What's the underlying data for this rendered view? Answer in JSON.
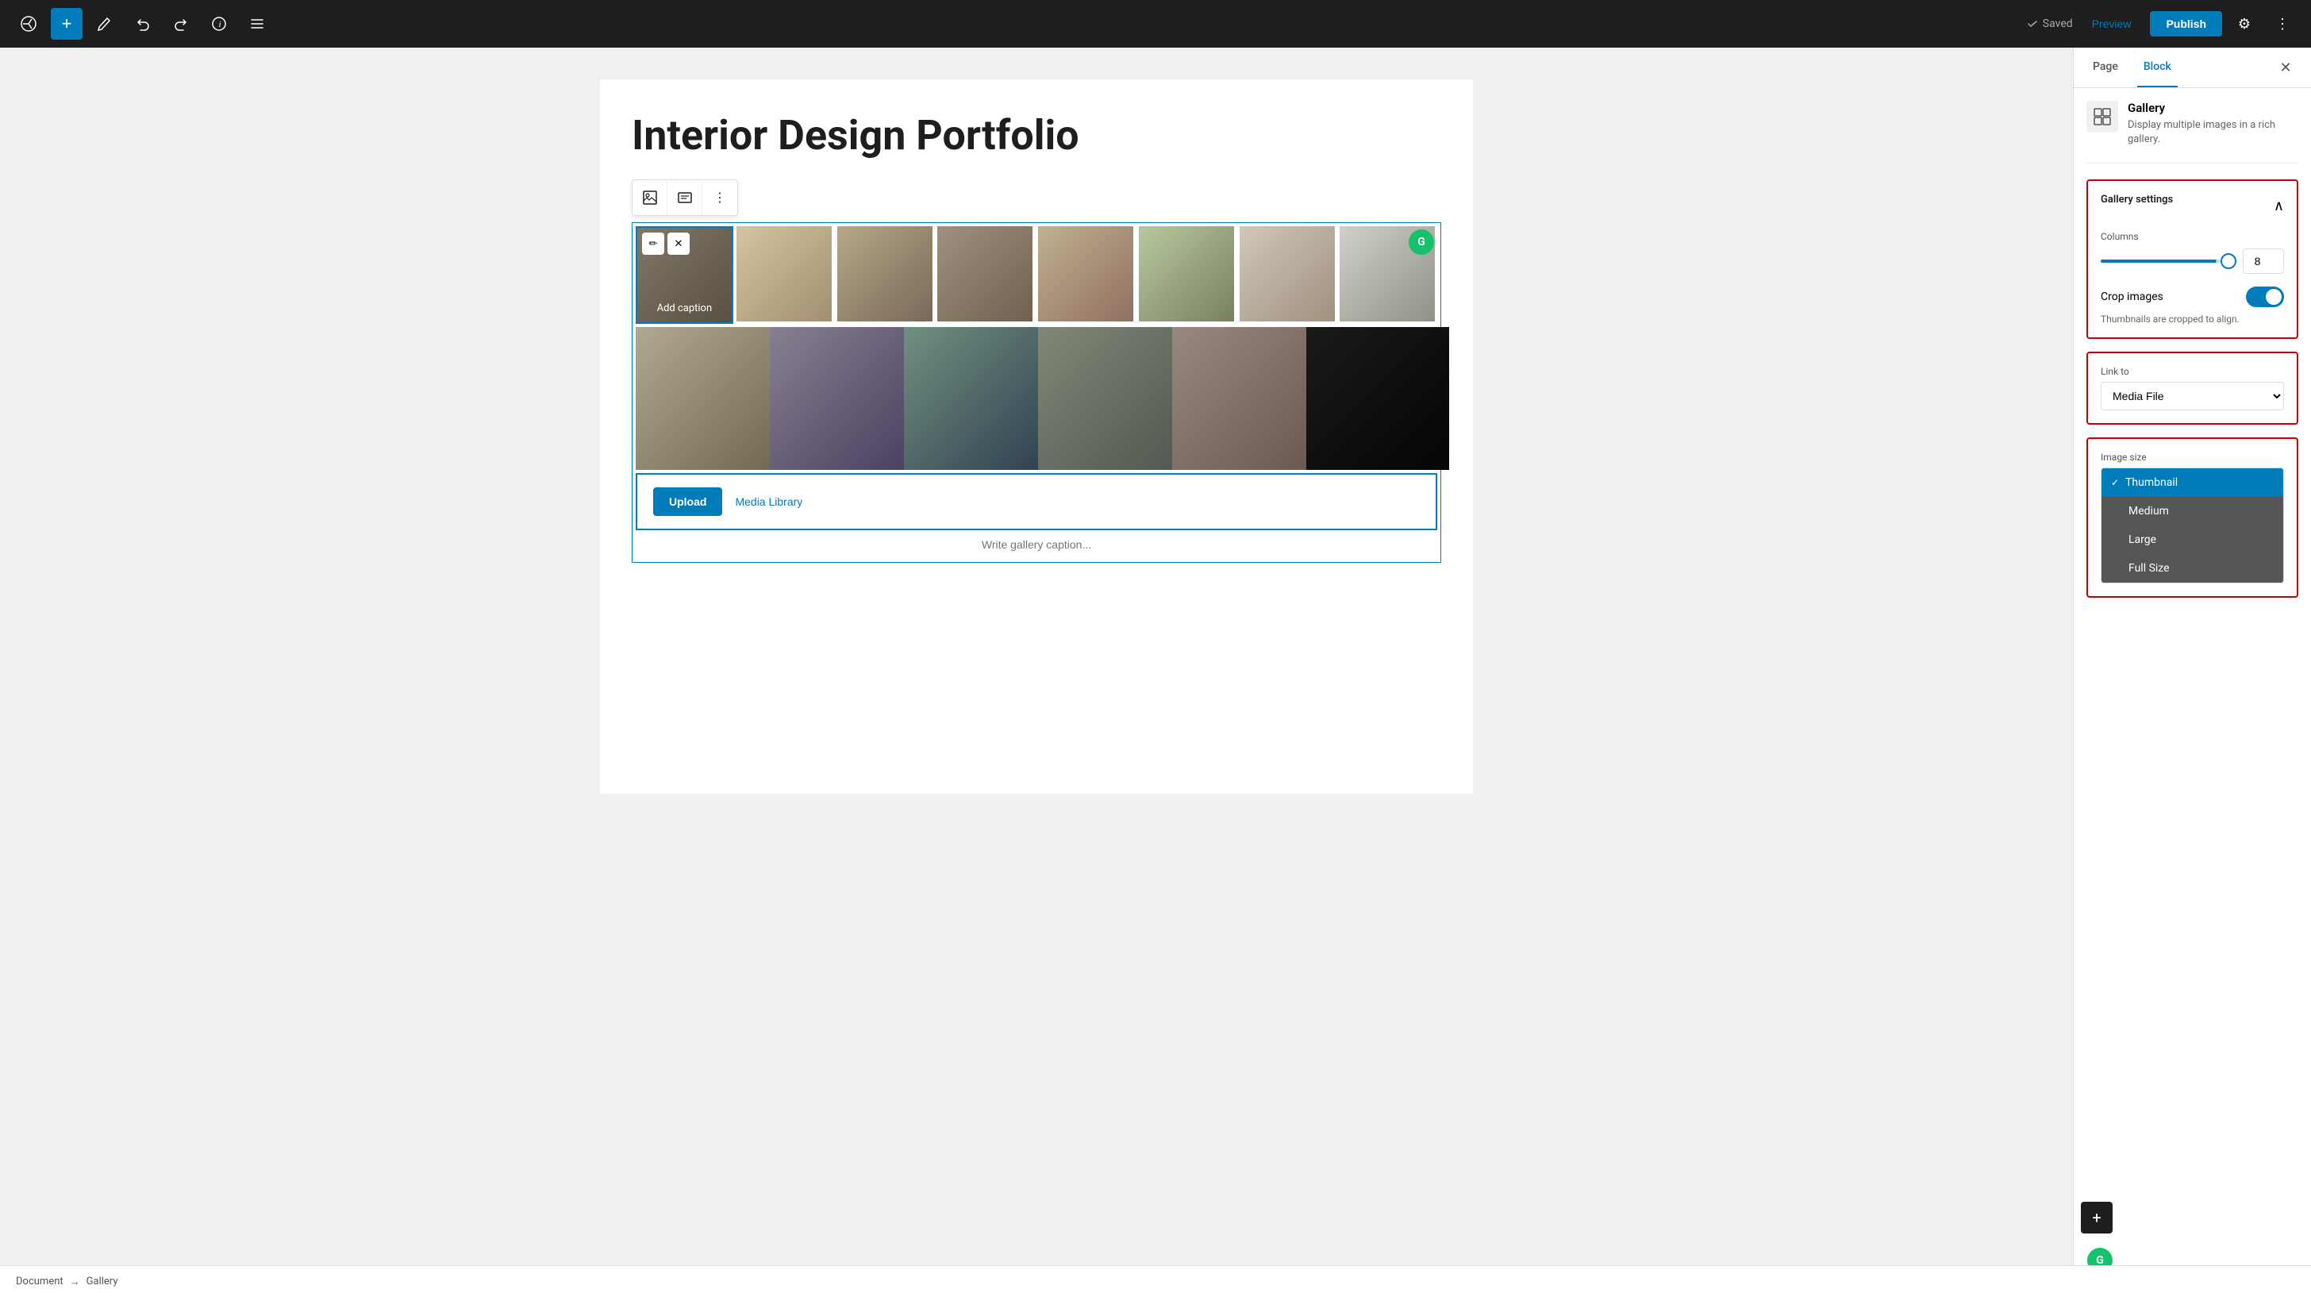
{
  "toolbar": {
    "add_label": "+",
    "saved_label": "Saved",
    "preview_label": "Preview",
    "publish_label": "Publish"
  },
  "editor": {
    "page_title": "Interior Design Portfolio",
    "gallery_caption_placeholder": "Write gallery caption...",
    "add_caption": "Add caption",
    "upload_label": "Upload",
    "media_library_label": "Media Library",
    "columns_value": "8",
    "crop_images_label": "Crop images",
    "crop_images_hint": "Thumbnails are cropped to align."
  },
  "sidebar": {
    "page_tab": "Page",
    "block_tab": "Block",
    "block_name": "Gallery",
    "block_description": "Display multiple images in a rich gallery.",
    "gallery_settings_title": "Gallery settings",
    "columns_label": "Columns",
    "link_to_label": "Link to",
    "link_to_value": "Media File",
    "image_size_label": "Image size",
    "image_size_options": [
      "Thumbnail",
      "Medium",
      "Large",
      "Full Size"
    ],
    "image_size_selected": "Thumbnail"
  },
  "breadcrumb": {
    "document": "Document",
    "arrow": "→",
    "gallery": "Gallery"
  }
}
